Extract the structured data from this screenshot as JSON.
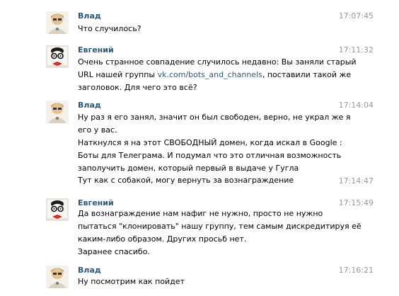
{
  "messages": [
    {
      "author": "Влад",
      "avatar_icon": "vlad-avatar-icon",
      "time": "17:07:45",
      "lines": [
        "Что случилось?"
      ]
    },
    {
      "author": "Евгений",
      "avatar_icon": "evgeny-avatar-icon",
      "time": "17:11:32",
      "line1": "Очень странное совпадение случилось недавно: Вы заняли старый",
      "line2_before": "URL нашей группы ",
      "line2_link": "vk.com/bots_and_channels",
      "line2_after": ", поставили такой же",
      "line3": "заголовок. Для чего это всё?"
    },
    {
      "author": "Влад",
      "avatar_icon": "vlad-avatar-icon",
      "time": "17:14:04",
      "lines": [
        "Ну раз я его занял, значит он был свободен, верно, не украл же я",
        "его у вас.",
        "Наткнулся я на этот СВОБОДНЫЙ домен, когда искал в Google :",
        "Боты для Телеграма. И подумал что это отличная возможность",
        "заполучить домен, который первый в выдаче у Гугла"
      ]
    },
    {
      "time": "17:14:47",
      "lines": [
        "Тут как с собакой, могу вернуть за вознаграждение"
      ]
    },
    {
      "author": "Евгений",
      "avatar_icon": "evgeny-avatar-icon",
      "time": "17:15:49",
      "lines": [
        "Да вознаграждение нам нафиг не нужно, просто не нужно",
        "пытаться \"клонировать\" нашу группу, тем самым дискредитируя её",
        "каким-либо образом. Других просьб нет.",
        "Заранее спасибо."
      ]
    },
    {
      "author": "Влад",
      "avatar_icon": "vlad-avatar-icon",
      "time": "17:16:21",
      "lines": [
        "Ну посмотрим как пойдет"
      ]
    }
  ]
}
